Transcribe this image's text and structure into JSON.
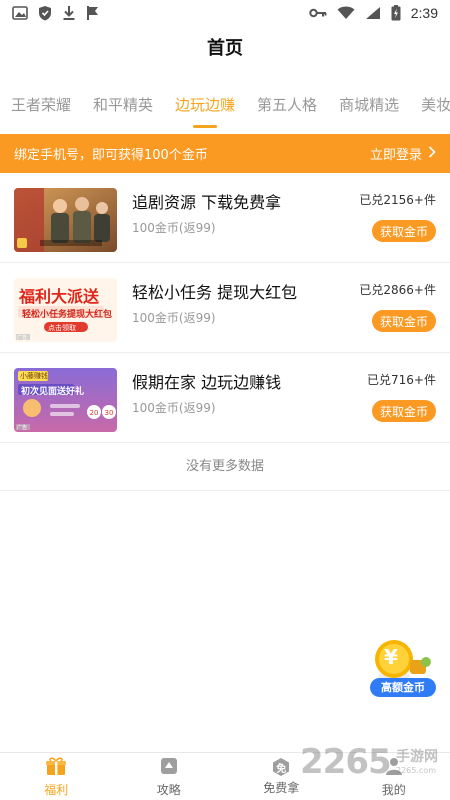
{
  "status_bar": {
    "time": "2:39"
  },
  "header": {
    "title": "首页"
  },
  "tabs": [
    {
      "label": "王者荣耀"
    },
    {
      "label": "和平精英"
    },
    {
      "label": "边玩边赚"
    },
    {
      "label": "第五人格"
    },
    {
      "label": "商城精选"
    },
    {
      "label": "美妆护"
    }
  ],
  "active_tab": 2,
  "banner": {
    "text": "绑定手机号，即可获得100个金币",
    "link_label": "立即登录"
  },
  "items": [
    {
      "title": "追剧资源 下载免费拿",
      "price": "100金币(返99)",
      "count": "已兑2156+件",
      "button": "获取金币"
    },
    {
      "title": "轻松小任务 提现大红包",
      "price": "100金币(返99)",
      "count": "已兑2866+件",
      "button": "获取金币",
      "thumb_text": {
        "big": "福利大派送",
        "sub": "轻松小任务提现大红包",
        "cta": "点击领取",
        "ad": "广告"
      }
    },
    {
      "title": "假期在家 边玩边赚钱",
      "price": "100金币(返99)",
      "count": "已兑716+件",
      "button": "获取金币",
      "thumb_text": {
        "tag": "小藤赚钱",
        "big": "初次见面送好礼",
        "ad": "广告"
      }
    }
  ],
  "no_more": "没有更多数据",
  "float_coin": {
    "symbol": "¥",
    "label": "高额金币"
  },
  "bottom_nav": [
    {
      "label": "福利",
      "icon": "gift-icon"
    },
    {
      "label": "攻略",
      "icon": "guide-icon"
    },
    {
      "label": "免费拿",
      "icon": "free-icon",
      "icon_glyph": "免"
    },
    {
      "label": "我的",
      "icon": "user-icon"
    }
  ],
  "watermark": {
    "number": "2265",
    "text": "手游网",
    "url": "2265.com"
  },
  "colors": {
    "accent": "#f5a51d",
    "banner": "#fb9a23",
    "button": "#fb9a23",
    "float_label": "#2f7cf6"
  }
}
